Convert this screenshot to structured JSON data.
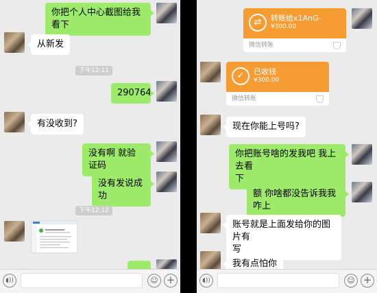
{
  "left_chat": {
    "msg1": "你把个人中心截图给我看下",
    "msg2": "从新发",
    "time1": "下午12:11",
    "msg3": "290764",
    "msg4": "有没收到?",
    "msg5": "没有啊 就验证码",
    "msg6": "没有发说成功",
    "time2": "下午12:12"
  },
  "right_chat": {
    "transfer1": {
      "title": "转账给x1AnG-",
      "amount": "¥300.00",
      "footer": "微信转账",
      "icon": "transfer-arrows-icon"
    },
    "transfer2": {
      "title": "已收钱",
      "amount": "¥300.00",
      "footer": "微信转账",
      "icon": "check-icon"
    },
    "msg1": "现在你能上号吗?",
    "msg2_line1": "你把账号啥的发我吧 我上去看",
    "msg2_line2": "下",
    "msg3": "额 你啥都没告诉我我咋上",
    "msg4_line1": "账号就是上面发给你的图片有",
    "msg4_line2": "写",
    "msg5": "我有点怕你"
  },
  "colors": {
    "outgoing": "#9eea6a",
    "incoming": "#ffffff",
    "transfer": "#f79c33",
    "background": "#ebebeb"
  }
}
